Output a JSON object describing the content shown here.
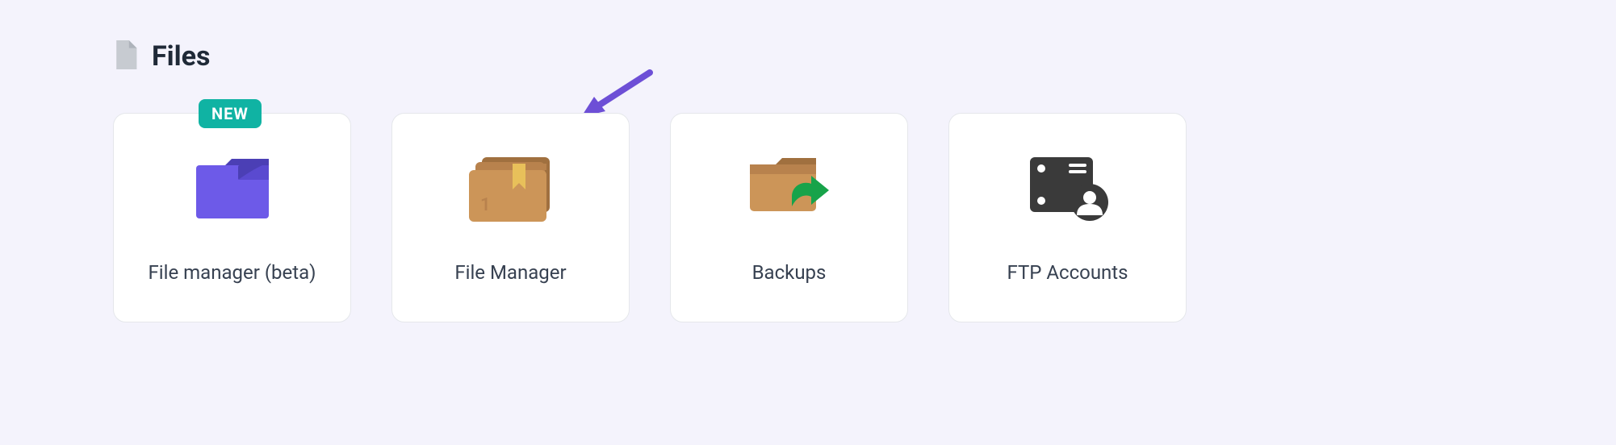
{
  "section": {
    "title": "Files"
  },
  "cards": {
    "item0": {
      "label": "File manager (beta)",
      "badge": "NEW"
    },
    "item1": {
      "label": "File Manager"
    },
    "item2": {
      "label": "Backups"
    },
    "item3": {
      "label": "FTP Accounts"
    }
  }
}
